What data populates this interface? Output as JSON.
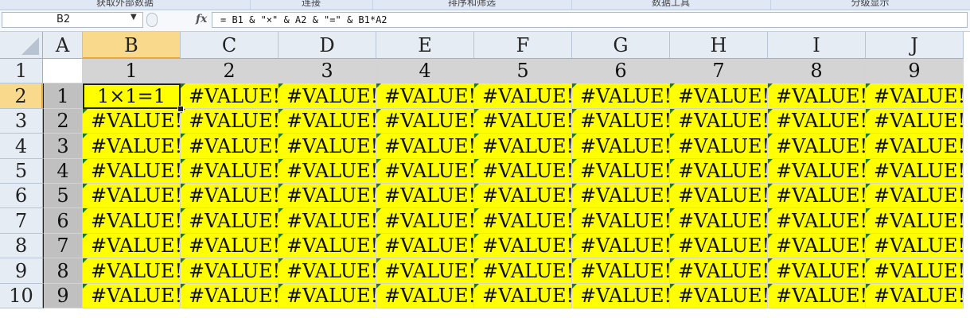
{
  "ribbon": {
    "groups": [
      "获取外部数据",
      "连接",
      "排序和筛选",
      "数据工具",
      "分级显示"
    ]
  },
  "formula_bar": {
    "name_box": "B2",
    "fx_label": "fx",
    "formula": "= B1 & \"×\" & A2 & \"=\" & B1*A2"
  },
  "sheet": {
    "columns": [
      "A",
      "B",
      "C",
      "D",
      "E",
      "F",
      "G",
      "H",
      "I",
      "J"
    ],
    "rows": [
      "1",
      "2",
      "3",
      "4",
      "5",
      "6",
      "7",
      "8",
      "9",
      "10"
    ],
    "selected_column": "B",
    "selected_row": "2",
    "header_row_values": [
      "",
      "1",
      "2",
      "3",
      "4",
      "5",
      "6",
      "7",
      "8",
      "9"
    ],
    "row_labels": [
      "1",
      "2",
      "3",
      "4",
      "5",
      "6",
      "7",
      "8",
      "9"
    ],
    "active_cell_value": "1×1=1",
    "error_value": "#VALUE!",
    "colors": {
      "cell_fill": "#ffff00",
      "header_fill": "#d4d4d4",
      "row_label_fill": "#c0c0c0",
      "selection_header": "#f9d98c",
      "error_indicator": "#1e7a1e"
    }
  }
}
